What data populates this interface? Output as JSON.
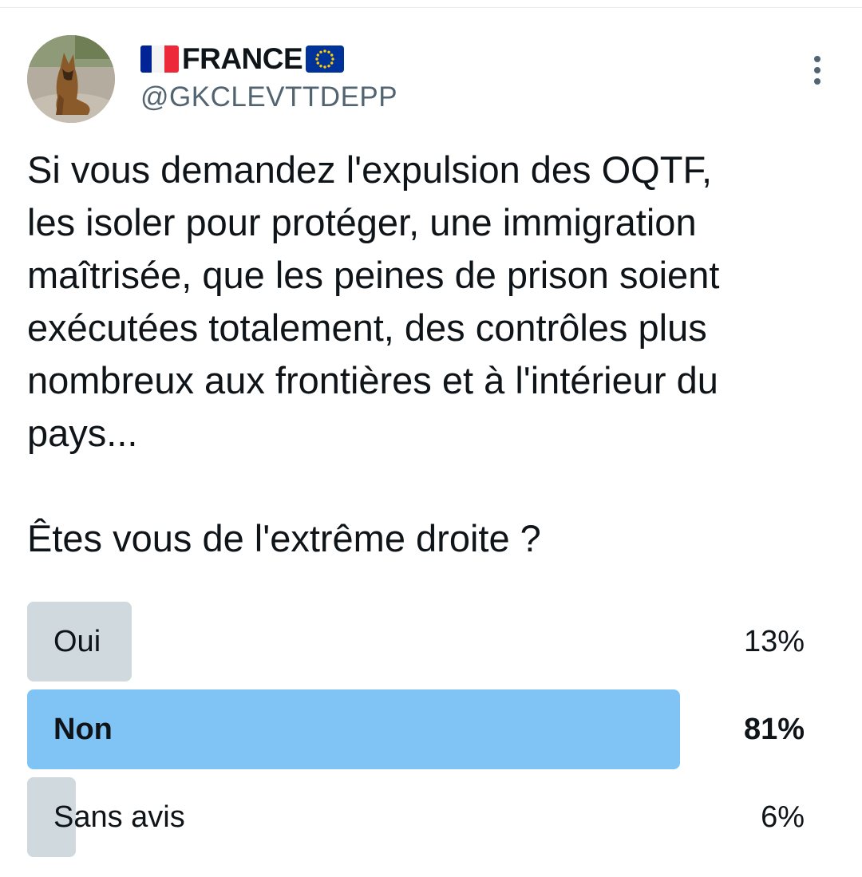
{
  "author": {
    "display_name": "FRANCE",
    "flag_left": "flag-france",
    "flag_right": "flag-european-union",
    "handle": "@GKCLEVTTDEPP"
  },
  "tweet": {
    "text": "Si vous demandez l'expulsion des OQTF,\nles isoler pour protéger, une immigration\nmaîtrisée, que les peines de prison soient\nexécutées totalement, des contrôles plus\nnombreux aux frontières et à l'intérieur du\npays...\n\nÊtes vous de l'extrême droite ?"
  },
  "poll": {
    "options": [
      {
        "label": "Oui",
        "percent_label": "13%",
        "percent": 13,
        "winner": false
      },
      {
        "label": "Non",
        "percent_label": "81%",
        "percent": 81,
        "winner": true
      },
      {
        "label": "Sans avis",
        "percent_label": "6%",
        "percent": 6,
        "winner": false
      }
    ]
  },
  "colors": {
    "text": "#0f1419",
    "secondary_text": "#536471",
    "poll_winner_bar": "#7fc4f4",
    "poll_bar": "#cfd9de"
  },
  "icons": {
    "more": "more-vertical-icon"
  }
}
